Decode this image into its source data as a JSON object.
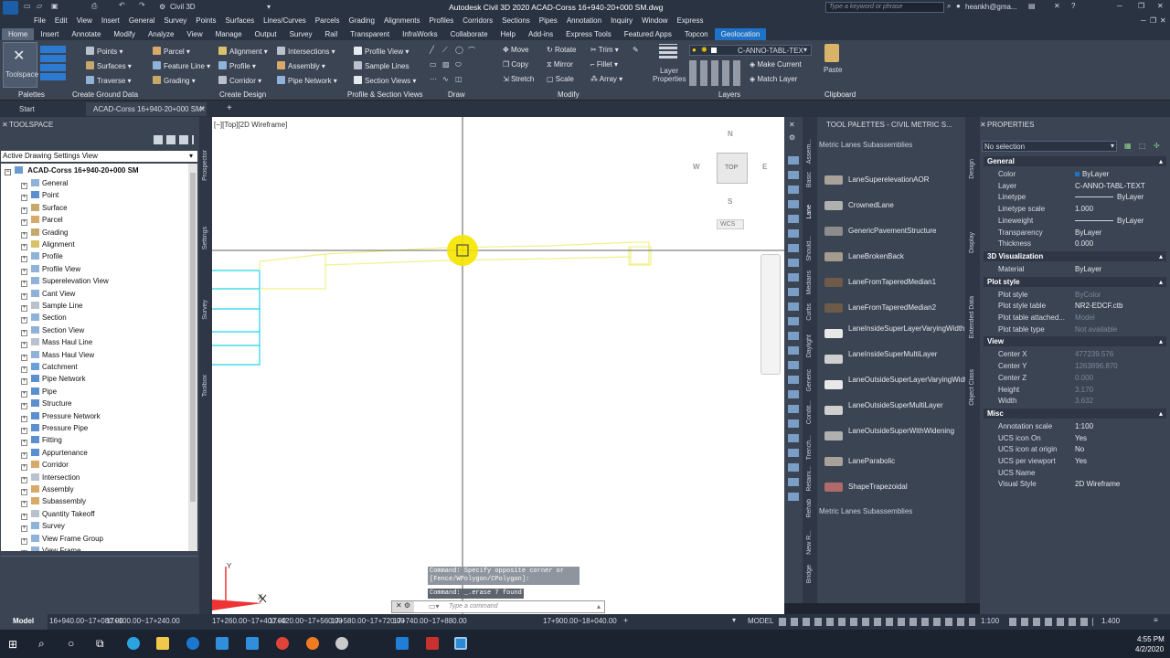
{
  "title": {
    "app_search": "Civil 3D",
    "window_title": "Autodesk Civil 3D 2020    ACAD-Corss 16+940-20+000 SM.dwg",
    "search_placeholder": "Type a keyword or phrase",
    "user": "heankh@gma..."
  },
  "menu": [
    "File",
    "Edit",
    "View",
    "Insert",
    "General",
    "Survey",
    "Points",
    "Surfaces",
    "Lines/Curves",
    "Parcels",
    "Grading",
    "Alignments",
    "Profiles",
    "Corridors",
    "Sections",
    "Pipes",
    "Annotation",
    "Inquiry",
    "Window",
    "Express"
  ],
  "tabs": [
    "Home",
    "Insert",
    "Annotate",
    "Modify",
    "Analyze",
    "View",
    "Manage",
    "Output",
    "Survey",
    "Rail",
    "Transparent",
    "InfraWorks",
    "Collaborate",
    "Help",
    "Add-ins",
    "Express Tools",
    "Featured Apps",
    "Topcon",
    "Geolocation"
  ],
  "ribbon": {
    "toolspace": "Toolspace",
    "palettes": "Palettes",
    "points": "Points",
    "surfaces": "Surfaces",
    "traverse": "Traverse",
    "create_ground_data": "Create Ground Data",
    "parcel": "Parcel",
    "feature_line": "Feature Line",
    "grading": "Grading",
    "alignment": "Alignment",
    "profile": "Profile",
    "corridor": "Corridor",
    "intersections": "Intersections",
    "assembly": "Assembly",
    "pipe_network": "Pipe Network",
    "create_design": "Create Design",
    "profile_view": "Profile View",
    "sample_lines": "Sample Lines",
    "section_views": "Section Views",
    "profile_section_views": "Profile & Section Views",
    "draw": "Draw",
    "move": "Move",
    "copy": "Copy",
    "stretch": "Stretch",
    "rotate": "Rotate",
    "mirror": "Mirror",
    "scale": "Scale",
    "trim": "Trim",
    "fillet": "Fillet",
    "array": "Array",
    "modify": "Modify",
    "layer_properties": "Layer Properties",
    "layer_name": "C-ANNO-TABL-TEX",
    "make_current": "Make Current",
    "match_layer": "Match Layer",
    "layers": "Layers",
    "paste": "Paste",
    "clipboard": "Clipboard"
  },
  "doctabs": {
    "start": "Start",
    "active": "ACAD-Corss 16+940-20+000 SM*"
  },
  "toolspace": {
    "title": "TOOLSPACE",
    "view_select": "Active Drawing Settings View",
    "root": "ACAD-Corss 16+940-20+000 SM",
    "items": [
      "General",
      "Point",
      "Surface",
      "Parcel",
      "Grading",
      "Alignment",
      "Profile",
      "Profile View",
      "Superelevation View",
      "Cant View",
      "Sample Line",
      "Section",
      "Section View",
      "Mass Haul Line",
      "Mass Haul View",
      "Catchment",
      "Pipe Network",
      "Pipe",
      "Structure",
      "Pressure Network",
      "Pressure Pipe",
      "Fitting",
      "Appurtenance",
      "Corridor",
      "Intersection",
      "Assembly",
      "Subassembly",
      "Quantity Takeoff",
      "Survey",
      "View Frame Group",
      "View Frame"
    ],
    "vtabs": [
      "Prospector",
      "Settings",
      "Survey",
      "Toolbox"
    ]
  },
  "viewport": {
    "label": "[−][Top][2D Wireframe]",
    "viewcube": {
      "n": "N",
      "s": "S",
      "e": "E",
      "w": "W",
      "top": "TOP",
      "wcs": "WCS"
    },
    "ucs_y": "Y",
    "ucs_x": "X",
    "cmd_history": [
      "Command: Specify opposite corner or [Fence/WPolygon/CPolygon]:",
      "Command: _.erase 7 found"
    ],
    "cmd_placeholder": "Type a command"
  },
  "toolpalettes": {
    "title": "TOOL PALETTES - CIVIL METRIC S...",
    "header": "Metric Lanes Subassemblies",
    "footer": "Metric Lanes Subassemblies",
    "items": [
      "LaneSuperelevationAOR",
      "CrownedLane",
      "GenericPavementStructure",
      "LaneBrokenBack",
      "LaneFromTaperedMedian1",
      "LaneFromTaperedMedian2",
      "LaneInsideSuperLayerVaryingWidth",
      "LaneInsideSuperMultiLayer",
      "LaneOutsideSuperLayerVaryingWidth",
      "LaneOutsideSuperMultiLayer",
      "LaneOutsideSuperWithWidening",
      "LaneParabolic",
      "ShapeTrapezoidal"
    ],
    "vtabs": [
      "Assem...",
      "Basic",
      "Lane",
      "Should...",
      "Medians",
      "Curbs",
      "Daylight",
      "Generic",
      "Condit...",
      "Trench...",
      "Retaini...",
      "Rehab",
      "New R...",
      "Bridge"
    ]
  },
  "properties": {
    "title": "PROPERTIES",
    "selection": "No selection",
    "vtabs": [
      "Design",
      "Display",
      "Extended Data",
      "Object Class"
    ],
    "sections": [
      {
        "name": "General",
        "rows": [
          [
            "Color",
            "ByLayer"
          ],
          [
            "Layer",
            "C-ANNO-TABL-TEXT"
          ],
          [
            "Linetype",
            "ByLayer"
          ],
          [
            "Linetype scale",
            "1.000"
          ],
          [
            "Lineweight",
            "ByLayer"
          ],
          [
            "Transparency",
            "ByLayer"
          ],
          [
            "Thickness",
            "0.000"
          ]
        ]
      },
      {
        "name": "3D Visualization",
        "rows": [
          [
            "Material",
            "ByLayer"
          ]
        ]
      },
      {
        "name": "Plot style",
        "rows": [
          [
            "Plot style",
            "ByColor"
          ],
          [
            "Plot style table",
            "NR2-EDCF.ctb"
          ],
          [
            "Plot table attached...",
            "Model"
          ],
          [
            "Plot table type",
            "Not available"
          ]
        ]
      },
      {
        "name": "View",
        "rows": [
          [
            "Center X",
            "477239.576"
          ],
          [
            "Center Y",
            "1263896.870"
          ],
          [
            "Center Z",
            "0.000"
          ],
          [
            "Height",
            "3.170"
          ],
          [
            "Width",
            "3.632"
          ]
        ]
      },
      {
        "name": "Misc",
        "rows": [
          [
            "Annotation scale",
            "1:100"
          ],
          [
            "UCS icon On",
            "Yes"
          ],
          [
            "UCS icon at origin",
            "No"
          ],
          [
            "UCS per viewport",
            "Yes"
          ],
          [
            "UCS Name",
            ""
          ],
          [
            "Visual Style",
            "2D Wireframe"
          ]
        ]
      }
    ]
  },
  "status": {
    "model_tab": "Model",
    "layouts": [
      "16+940.00~17+080.00",
      "17+100.00~17+240.00",
      "17+260.00~17+400.00",
      "17+420.00~17+560.00",
      "17+580.00~17+720.00",
      "17+740.00~17+880.00",
      "17+900.00~18+040.00"
    ],
    "model": "MODEL",
    "scale": "1:100",
    "zoom": "1.400"
  },
  "taskbar": {
    "time": "4:55 PM",
    "date": "4/2/2020"
  },
  "colors": {
    "accent": "#1e73c8",
    "panel": "#3b4453",
    "dark": "#2a3342",
    "crosshair_marker": "#f5e400"
  }
}
